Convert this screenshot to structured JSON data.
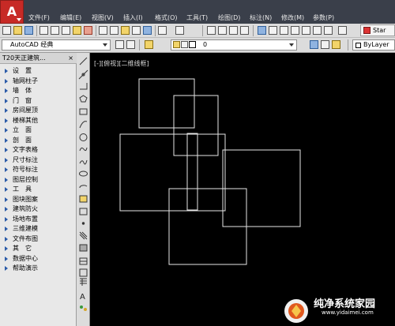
{
  "menu": {
    "items": [
      "文件(F)",
      "编辑(E)",
      "视图(V)",
      "插入(I)",
      "格式(O)",
      "工具(T)",
      "绘图(D)",
      "标注(N)",
      "修改(M)",
      "参数(P)"
    ]
  },
  "toolbar": {
    "start_label": "Star"
  },
  "workspace": {
    "selected": "AutoCAD 经典"
  },
  "layer": {
    "current": "0"
  },
  "properties": {
    "color": "ByLayer"
  },
  "panel": {
    "title": "T20天正建筑...",
    "close": "×",
    "items": [
      "设　置",
      "轴网柱子",
      "墙　体",
      "门　窗",
      "房间屋顶",
      "楼梯其他",
      "立　面",
      "剖　面",
      "文字表格",
      "尺寸标注",
      "符号标注",
      "图层控制",
      "工　具",
      "图块图案",
      "建筑防火",
      "场地布置",
      "三维建模",
      "文件布图",
      "其　它",
      "数据中心",
      "帮助演示"
    ]
  },
  "viewport": {
    "label": "[-][俯视][二维线框]"
  },
  "watermark": {
    "text": "纯净系统家园",
    "url": "www.yidaimei.com"
  },
  "colors": {
    "menubar": "#3a3f4a",
    "canvas": "#000000",
    "lines": "#ffffff",
    "app_button": "#c72a26"
  }
}
